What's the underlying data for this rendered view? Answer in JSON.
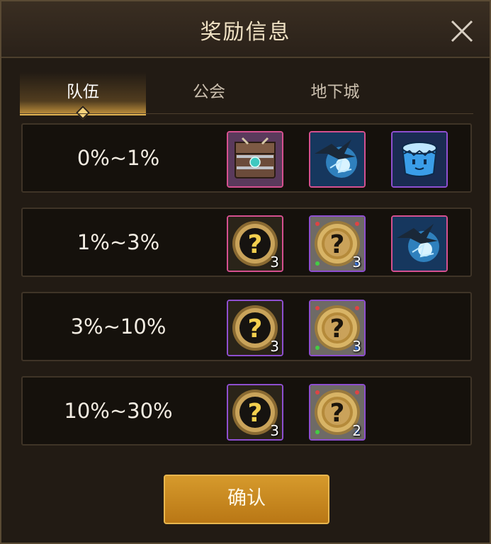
{
  "dialog": {
    "title": "奖励信息",
    "close_icon": "close-x-icon"
  },
  "tabs": [
    {
      "label": "队伍",
      "active": true
    },
    {
      "label": "公会",
      "active": false
    },
    {
      "label": "地下城",
      "active": false
    }
  ],
  "rows": [
    {
      "label": "0%~1%",
      "items": [
        {
          "icon": "treasure-chest-icon",
          "rarity": "pink",
          "count": ""
        },
        {
          "icon": "blue-dragon-icon",
          "rarity": "pink",
          "count": ""
        },
        {
          "icon": "blue-drum-face-icon",
          "rarity": "purple",
          "count": ""
        }
      ]
    },
    {
      "label": "1%~3%",
      "items": [
        {
          "icon": "mystery-coin-dark-icon",
          "rarity": "pink",
          "count": "3"
        },
        {
          "icon": "mystery-coin-gold-icon",
          "rarity": "purple",
          "count": "3"
        },
        {
          "icon": "blue-dragon-icon",
          "rarity": "pink",
          "count": ""
        }
      ]
    },
    {
      "label": "3%~10%",
      "items": [
        {
          "icon": "mystery-coin-dark-icon",
          "rarity": "purple",
          "count": "3"
        },
        {
          "icon": "mystery-coin-gold-icon",
          "rarity": "purple",
          "count": "3"
        }
      ]
    },
    {
      "label": "10%~30%",
      "items": [
        {
          "icon": "mystery-coin-dark-icon",
          "rarity": "purple",
          "count": "3"
        },
        {
          "icon": "mystery-coin-gold-icon",
          "rarity": "purple",
          "count": "2"
        }
      ]
    }
  ],
  "confirm_button": {
    "label": "确认"
  },
  "colors": {
    "accent": "#e2b451",
    "pink_rarity": "#d5508f",
    "purple_rarity": "#8e4fd0",
    "button": "#c98a22"
  }
}
